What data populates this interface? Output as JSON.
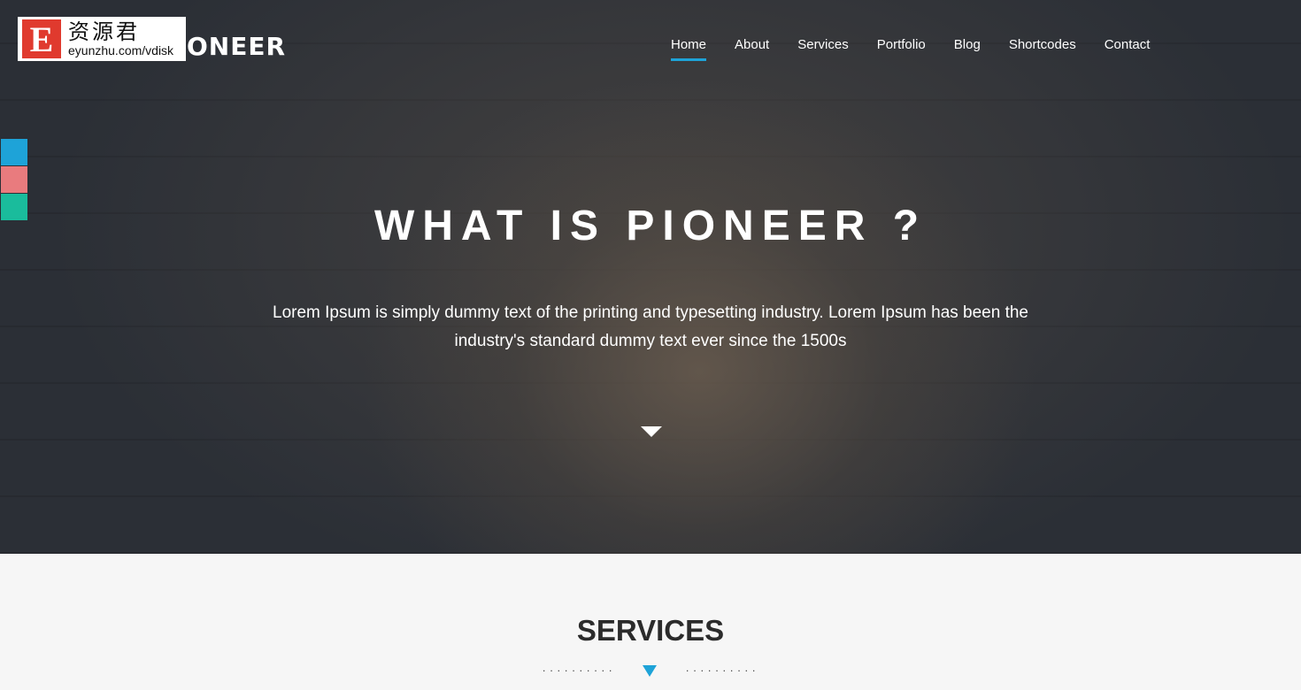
{
  "logo": {
    "letter": "E",
    "chinese": "资源君",
    "url": "eyunzhu.com/vdisk"
  },
  "brand": "ONEER",
  "nav": [
    {
      "label": "Home",
      "active": true
    },
    {
      "label": "About"
    },
    {
      "label": "Services"
    },
    {
      "label": "Portfolio"
    },
    {
      "label": "Blog"
    },
    {
      "label": "Shortcodes"
    },
    {
      "label": "Contact"
    }
  ],
  "accent": "#1ea3d8",
  "swatches": [
    "#1ea3d8",
    "#e97b7e",
    "#1abc9c"
  ],
  "hero": {
    "title": "WHAT IS PIONEER ?",
    "text": "Lorem Ipsum is simply dummy text of the printing and typesetting industry. Lorem Ipsum has been the industry's standard dummy text ever since the 1500s",
    "scroll_icon": "caret-down-icon"
  },
  "services": {
    "title": "SERVICES",
    "divider_icon": "caret-down-icon"
  }
}
